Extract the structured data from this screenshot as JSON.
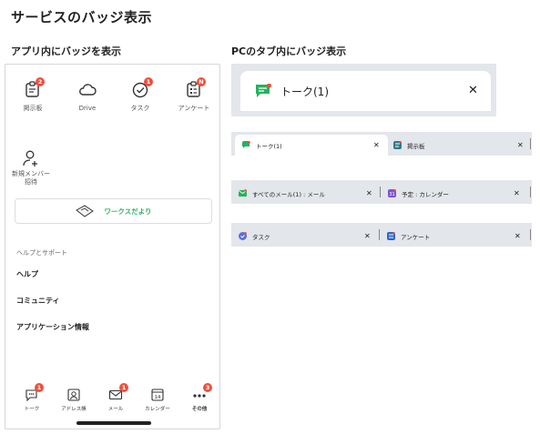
{
  "title": "サービスのバッジ表示",
  "section_app": "アプリ内にバッジを表示",
  "section_pc": "PCのタブ内にバッジ表示",
  "app": {
    "services": [
      {
        "label": "掲示板",
        "badge": "2",
        "icon": "board-icon"
      },
      {
        "label": "Drive",
        "badge": "",
        "icon": "cloud-icon"
      },
      {
        "label": "タスク",
        "badge": "1",
        "icon": "task-check-icon"
      },
      {
        "label": "アンケート",
        "badge": "N",
        "icon": "survey-icon"
      }
    ],
    "invite_label": "新規メンバー\n招待",
    "works_label": "ワークスだより",
    "help_header": "ヘルプとサポート",
    "help_items": [
      "ヘルプ",
      "コミュニティ",
      "アプリケーション情報"
    ],
    "tabbar": [
      {
        "label": "トーク",
        "badge": "1",
        "icon": "chat-icon"
      },
      {
        "label": "アドレス帳",
        "badge": "",
        "icon": "address-book-icon"
      },
      {
        "label": "メール",
        "badge": "1",
        "icon": "mail-icon"
      },
      {
        "label": "カレンダー",
        "badge": "",
        "icon": "calendar-icon",
        "day": "14"
      },
      {
        "label": "その他",
        "badge": "3",
        "icon": "more-icon"
      }
    ]
  },
  "pc": {
    "big_tab": {
      "label": "トーク(1)",
      "close": "✕"
    },
    "strips": [
      [
        {
          "label": "トーク(1)",
          "active": true,
          "icon_color": "#23b35d"
        },
        {
          "label": "掲示板",
          "active": false,
          "icon_color": "#2f7a8c"
        }
      ],
      [
        {
          "label": "すべてのメール(1) : メール",
          "active": false,
          "icon_color": "#23b35d"
        },
        {
          "label": "予定 : カレンダー",
          "active": false,
          "icon_color": "#7b52d6"
        }
      ],
      [
        {
          "label": "タスク",
          "active": false,
          "icon_color": "#5a6ee0"
        },
        {
          "label": "アンケート",
          "active": false,
          "icon_color": "#2d67c8"
        }
      ]
    ],
    "close_glyph": "✕"
  },
  "colors": {
    "badge": "#f14f3c",
    "accent_green": "#2fb36b",
    "tab_bg": "#e3e6ea"
  }
}
